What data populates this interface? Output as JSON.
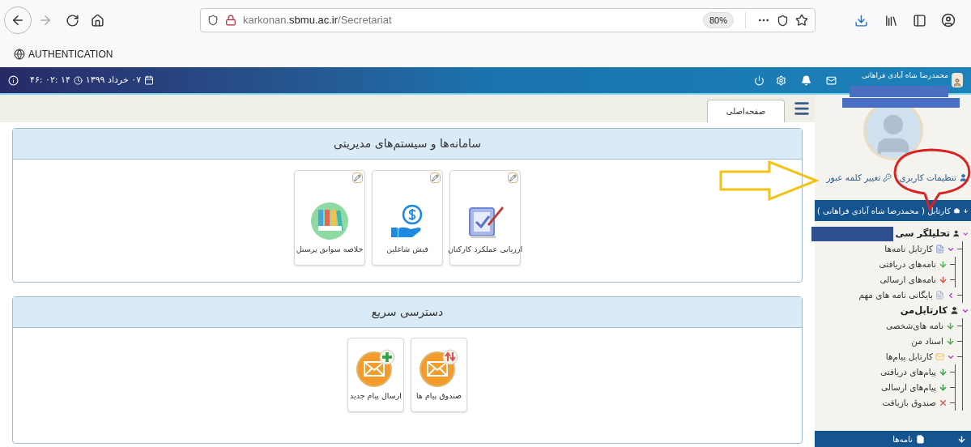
{
  "browser": {
    "url": {
      "subdomain": "karkonan.",
      "domain": "sbmu.ac.ir",
      "path": "/Secretariat"
    },
    "zoom": "80%",
    "bookmark": "AUTHENTICATION"
  },
  "header": {
    "time": "۴۶: ۰۲: ۱۴",
    "date": "۰۷ خرداد ۱۳۹۹",
    "user": "محمدرضا شاه آبادی فراهانی"
  },
  "tabs": [
    {
      "label": "صفحه‌اصلی",
      "selected": true
    }
  ],
  "panels": [
    {
      "title": "سامانه‌ها و سیستم‌های مدیریتی",
      "editable": true,
      "tiles": [
        {
          "label": "ارزیابی عملکرد کارکنان",
          "kind": "evaluation"
        },
        {
          "label": "فیش شاغلین",
          "kind": "payslip"
        },
        {
          "label": "خلاصه سوابق پرسنل",
          "kind": "records"
        }
      ]
    },
    {
      "title": "دسترسی سریع",
      "editable": false,
      "tiles": [
        {
          "label": "صندوق پیام ها",
          "kind": "inbox"
        },
        {
          "label": "ارسال پیام جدید",
          "kind": "compose"
        }
      ]
    }
  ],
  "sidebar": {
    "links": [
      "تنظیمات کاربری",
      "تغییر کلمه عبور"
    ],
    "cartable_title": "کارتابل ( محمدرضا شاه آبادی فراهانی )",
    "tree": [
      {
        "label": "تحلیلگر سی",
        "kind": "person",
        "expanded": true,
        "children": [
          {
            "label": "کارتابل نامه‌ها",
            "kind": "folder",
            "expanded": true,
            "children": [
              {
                "label": "نامه‌های دریافتی",
                "kind": "letter-in"
              },
              {
                "label": "نامه‌های ارسالی",
                "kind": "letter-out"
              }
            ]
          },
          {
            "label": "بایگانی نامه های مهم",
            "kind": "archive",
            "expanded": false
          }
        ]
      },
      {
        "label": "کارتابل‌من",
        "kind": "person",
        "expanded": true,
        "children": [
          {
            "label": "نامه های‌شخصی",
            "kind": "letter-in"
          },
          {
            "label": "اسناد من",
            "kind": "letter-in"
          },
          {
            "label": "کارتابل پیام‌ها",
            "kind": "mail",
            "expanded": true,
            "children": [
              {
                "label": "پیام‌های دریافتی",
                "kind": "mail-in"
              },
              {
                "label": "پیام‌های ارسالی",
                "kind": "mail-out"
              },
              {
                "label": "صندوق بازیافت",
                "kind": "trash"
              }
            ]
          }
        ]
      }
    ],
    "bottom_title": "نامه‌ها"
  }
}
